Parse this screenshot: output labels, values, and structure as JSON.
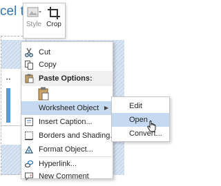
{
  "document": {
    "title_fragment": "cel t"
  },
  "mini_toolbar": {
    "style_label": "Style",
    "crop_label": "Crop"
  },
  "context_menu": {
    "cut": "Cut",
    "copy": "Copy",
    "paste_options": "Paste Options:",
    "worksheet_object": "Worksheet Object",
    "insert_caption": "Insert Caption...",
    "borders_shading": "Borders and Shading...",
    "format_object": "Format Object...",
    "hyperlink": "Hyperlink...",
    "new_comment": "New Comment"
  },
  "submenu": {
    "edit": "Edit",
    "open": "Open",
    "convert": "Convert..."
  },
  "colors": {
    "highlight": "#c5daf1",
    "accent": "#2e75b6",
    "chart_bar": "#5b9bd5"
  }
}
